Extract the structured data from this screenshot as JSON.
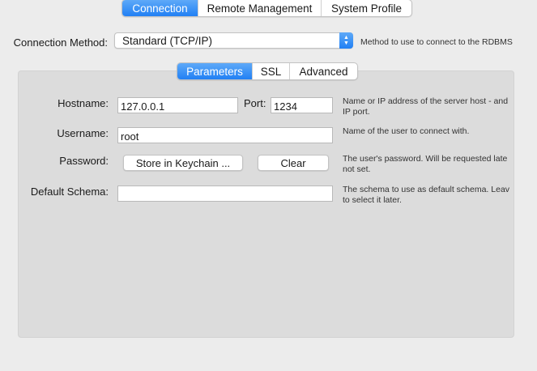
{
  "top_tabs": [
    {
      "label": "Connection",
      "active": true
    },
    {
      "label": "Remote Management",
      "active": false
    },
    {
      "label": "System Profile",
      "active": false
    }
  ],
  "connection_method": {
    "label": "Connection Method:",
    "value": "Standard (TCP/IP)",
    "help": "Method to use to connect to the RDBMS"
  },
  "sub_tabs": [
    {
      "label": "Parameters",
      "active": true
    },
    {
      "label": "SSL",
      "active": false
    },
    {
      "label": "Advanced",
      "active": false
    }
  ],
  "parameters": {
    "hostname": {
      "label": "Hostname:",
      "value": "127.0.0.1",
      "help_line1": "Name or IP address of the server host - and",
      "help_line2": "IP port."
    },
    "port": {
      "label": "Port:",
      "value": "1234"
    },
    "username": {
      "label": "Username:",
      "value": "root",
      "help": "Name of the user to connect with."
    },
    "password": {
      "label": "Password:",
      "store_button": "Store in Keychain ...",
      "clear_button": "Clear",
      "help_line1": "The user's password. Will be requested late",
      "help_line2": "not set."
    },
    "default_schema": {
      "label": "Default Schema:",
      "value": "",
      "help_line1": "The schema to use as default schema. Leav",
      "help_line2": "to select it later."
    }
  },
  "colors": {
    "accent": "#2180f4",
    "window_bg": "#ececec",
    "panel_bg": "#dcdcdc"
  }
}
